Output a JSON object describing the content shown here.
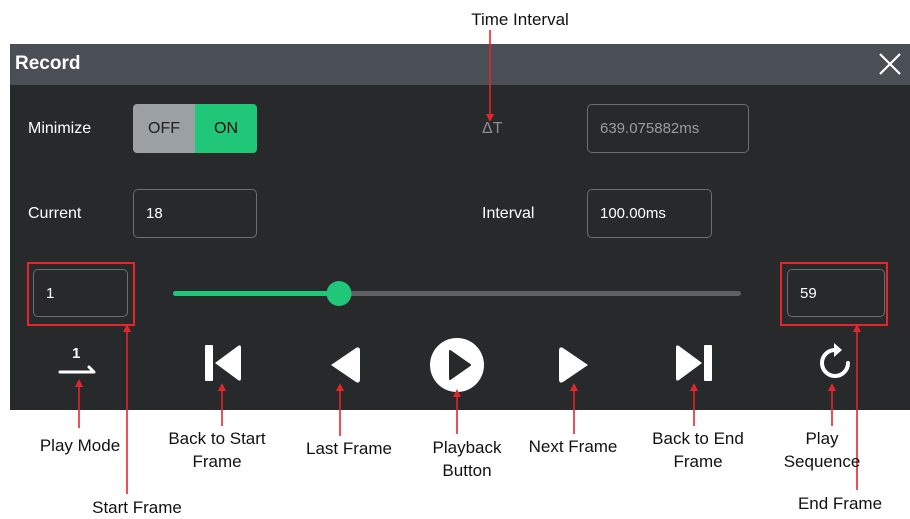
{
  "annotations": {
    "time_interval": "Time Interval",
    "play_mode": "Play Mode",
    "back_to_start_frame": "Back to Start Frame",
    "last_frame": "Last Frame",
    "playback_button": "Playback Button",
    "next_frame": "Next Frame",
    "back_to_end_frame": "Back to End Frame",
    "play_sequence": "Play Sequence",
    "start_frame": "Start Frame",
    "end_frame": "End Frame"
  },
  "dialog": {
    "title": "Record",
    "close_icon": "close-icon"
  },
  "minimize": {
    "label": "Minimize",
    "off": "OFF",
    "on": "ON",
    "state": "ON"
  },
  "delta_t": {
    "label": "ΔT",
    "value": "639.075882ms"
  },
  "current": {
    "label": "Current",
    "value": "18"
  },
  "interval": {
    "label": "Interval",
    "value": "100.00ms"
  },
  "frames": {
    "start": "1",
    "end": "59",
    "current": 18
  },
  "controls": {
    "play_mode_icon": "play-mode-icon",
    "play_mode_badge": "1",
    "back_to_start_icon": "skip-to-start-icon",
    "last_frame_icon": "previous-frame-icon",
    "playback_icon": "play-circle-icon",
    "next_frame_icon": "next-frame-icon",
    "back_to_end_icon": "skip-to-end-icon",
    "play_sequence_icon": "refresh-icon"
  },
  "colors": {
    "accent": "#20c778",
    "annotation": "#e3262b",
    "panel": "#27292b",
    "titlebar": "#4a4f55"
  }
}
